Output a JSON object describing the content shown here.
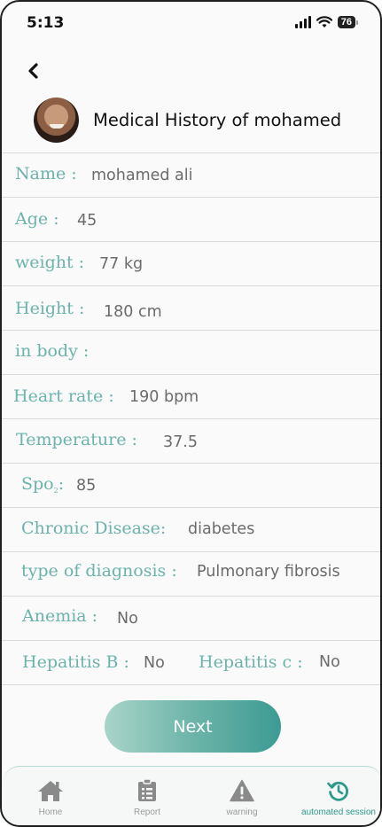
{
  "status_bar": {
    "time": "5:13",
    "battery": "76"
  },
  "header": {
    "title": "Medical History of mohamed"
  },
  "fields": {
    "name": {
      "label": "Name :",
      "value": "mohamed ali"
    },
    "age": {
      "label": "Age :",
      "value": "45"
    },
    "weight": {
      "label": "weight :",
      "value": "77 kg"
    },
    "height": {
      "label": "Height :",
      "value": "180 cm"
    },
    "in_body": {
      "label": "in body :",
      "value": ""
    },
    "heart_rate": {
      "label": "Heart rate :",
      "value": "190 bpm"
    },
    "temperature": {
      "label": "Temperature :",
      "value": "37.5"
    },
    "spo2": {
      "label": "Spo",
      "sub": "2",
      "colon": ":",
      "value": "85"
    },
    "chronic_disease": {
      "label": "Chronic Disease:",
      "value": "diabetes"
    },
    "diagnosis": {
      "label": "type of diagnosis :",
      "value": "Pulmonary fibrosis"
    },
    "anemia": {
      "label": "Anemia :",
      "value": "No"
    },
    "hepatitis_b": {
      "label": "Hepatitis B :",
      "value": "No"
    },
    "hepatitis_c": {
      "label": "Hepatitis c :",
      "value": "No"
    }
  },
  "next_button": "Next",
  "tabs": [
    {
      "label": "Home",
      "icon": "home-icon"
    },
    {
      "label": "Report",
      "icon": "report-icon"
    },
    {
      "label": "warning",
      "icon": "warning-icon"
    },
    {
      "label": "automated session",
      "icon": "history-icon"
    }
  ],
  "colors": {
    "accent": "#6bb3ac",
    "active_tab": "#2e9a8c",
    "value_text": "#6b6b6b"
  }
}
